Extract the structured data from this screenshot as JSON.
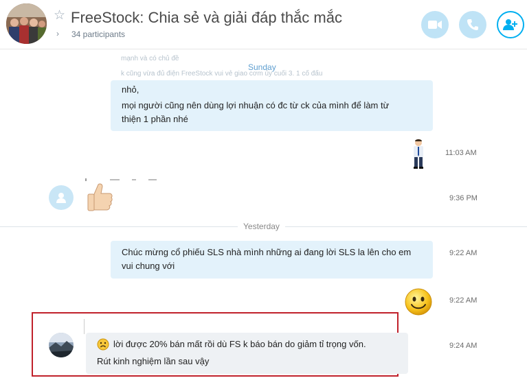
{
  "header": {
    "title": "FreeStock: Chia sẻ và giải đáp thắc mắc",
    "participants": "34 participants"
  },
  "chat": {
    "faded_line_1": "mạnh và có chủ đề",
    "faded_line_2": "k cũng vừa đủ điện FreeStock vui vẻ giao cơm ủy cuối 3. 1 cố đấu",
    "day_label": "Sunday",
    "msg_1": {
      "line_1": "nhỏ,",
      "line_2": "mọi người cũng nên dùng lợi nhuận có đc từ ck của mình để làm từ",
      "line_3": "thiện 1 phần nhé"
    },
    "time_1": "11:03 AM",
    "time_2": "9:36 PM",
    "separator": "Yesterday",
    "msg_2": {
      "line_1": "Chúc mừng cổ phiếu SLS nhà mình những ai đang lời SLS la lên cho em",
      "line_2": "vui chung với"
    },
    "time_3": "9:22 AM",
    "time_4": "9:22 AM",
    "msg_3": {
      "line_1": "lời được 20% bán mất rồi dù FS k báo bán do giảm tỉ trọng vốn.",
      "line_2": "Rút kinh nghiệm lần sau vậy"
    },
    "time_5": "9:24 AM"
  },
  "colors": {
    "accent": "#00aff0",
    "outgoing_bubble": "#e3f2fb",
    "incoming_bubble": "#eef1f4",
    "highlight": "#c0202a"
  }
}
